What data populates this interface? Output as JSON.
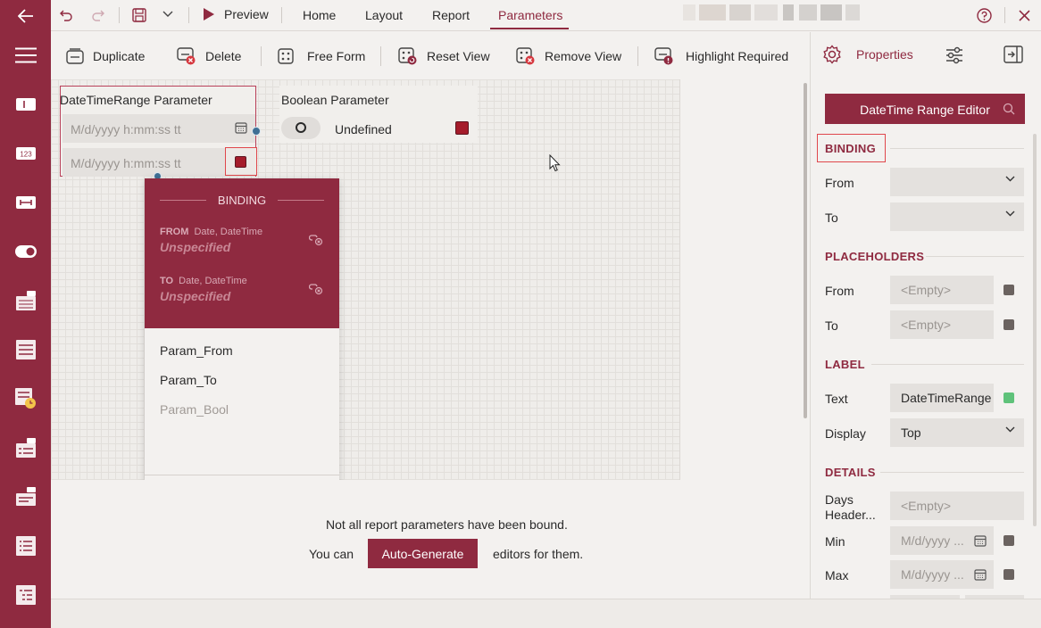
{
  "colors": {
    "brand": "#8f2a40",
    "highlight": "#e0474c",
    "green": "#5fc27a"
  },
  "titlebar": {
    "preview": "Preview",
    "tabs": [
      "Home",
      "Layout",
      "Report",
      "Parameters"
    ],
    "active_tab": "Parameters"
  },
  "toolbar": {
    "duplicate": "Duplicate",
    "delete": "Delete",
    "free_form": "Free Form",
    "reset_view": "Reset View",
    "remove_view": "Remove View",
    "highlight_required": "Highlight Required",
    "properties": "Properties"
  },
  "canvas": {
    "datetime_title": "DateTimeRange Parameter",
    "from_placeholder": "M/d/yyyy h:mm:ss tt",
    "to_placeholder": "M/d/yyyy h:mm:ss tt",
    "bool_title": "Boolean Parameter",
    "bool_value": "Undefined"
  },
  "popup": {
    "title": "BINDING",
    "from_label": "FROM",
    "from_types": "Date, DateTime",
    "from_value": "Unspecified",
    "to_label": "TO",
    "to_types": "Date, DateTime",
    "to_value": "Unspecified",
    "items": [
      "Param_From",
      "Param_To",
      "Param_Bool"
    ]
  },
  "notice": {
    "line1": "Not all report parameters have been bound.",
    "you_can": "You can",
    "button": "Auto-Generate",
    "suffix": "editors for them."
  },
  "panel": {
    "editor_button": "DateTime Range Editor",
    "binding_section": "BINDING",
    "from": "From",
    "to": "To",
    "placeholders_section": "PLACEHOLDERS",
    "ph_from": "From",
    "ph_from_value": "<Empty>",
    "ph_to": "To",
    "ph_to_value": "<Empty>",
    "label_section": "LABEL",
    "text": "Text",
    "text_value": "DateTimeRange",
    "display": "Display",
    "display_value": "Top",
    "details_section": "DETAILS",
    "days_header": "Days Header...",
    "days_header_value": "<Empty>",
    "min": "Min",
    "min_value": "M/d/yyyy ...",
    "max": "Max",
    "max_value": "M/d/yyyy ..."
  }
}
